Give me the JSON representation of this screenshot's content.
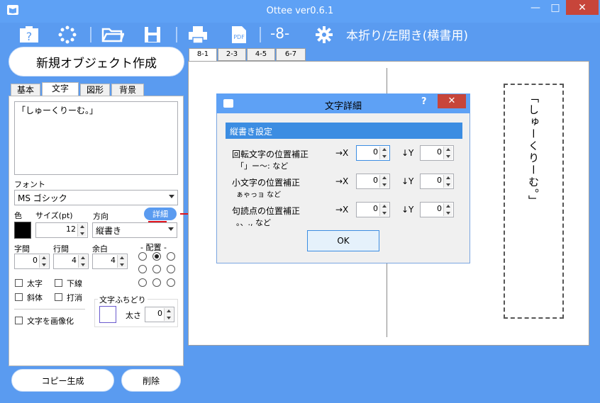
{
  "window": {
    "title": "Ottee ver0.6.1",
    "minimize": "—",
    "maximize": "□",
    "close": "✕"
  },
  "toolbar": {
    "page_indicator": "-8-",
    "layout_label": "本折り/左開き(横書用)"
  },
  "left": {
    "new_object_button": "新規オブジェクト作成",
    "tabs": [
      "基本",
      "文字",
      "図形",
      "背景"
    ],
    "text_value": "「しゅーくりーむ。」",
    "font_label": "フォント",
    "font_value": "MS ゴシック",
    "color_label": "色",
    "size_label": "サイズ(pt)",
    "size_value": "12",
    "direction_label": "方向",
    "detail_button": "詳細",
    "direction_value": "縦書き",
    "char_spacing_label": "字間",
    "char_spacing_value": "0",
    "line_spacing_label": "行間",
    "line_spacing_value": "4",
    "margin_label": "余白",
    "margin_value": "4",
    "alignment_label": "- 配置 -",
    "bold_label": "太字",
    "underline_label": "下線",
    "italic_label": "斜体",
    "strike_label": "打消",
    "outline_group_label": "文字ふちどり",
    "outline_width_label": "太さ",
    "outline_width_value": "0",
    "rasterize_label": "文字を画像化",
    "copy_button": "コピー生成",
    "delete_button": "削除"
  },
  "doc_tabs": [
    "8-1",
    "2-3",
    "4-5",
    "6-7"
  ],
  "canvas": {
    "vertical_text": "「しゅーくりーむ。」"
  },
  "dialog": {
    "title": "文字詳細",
    "help": "?",
    "close": "✕",
    "section_header": "縦書き設定",
    "rows": [
      {
        "label": "回転文字の位置補正",
        "sub": "「」ー〜: など",
        "x_label": "→X",
        "x_value": "0",
        "y_label": "↓Y",
        "y_value": "0"
      },
      {
        "label": "小文字の位置補正",
        "sub": "ぁゃっョ など",
        "x_label": "→X",
        "x_value": "0",
        "y_label": "↓Y",
        "y_value": "0"
      },
      {
        "label": "句読点の位置補正",
        "sub": "。、., など",
        "x_label": "→X",
        "x_value": "0",
        "y_label": "↓Y",
        "y_value": "0"
      }
    ],
    "ok_button": "OK"
  },
  "colors": {
    "accent": "#5a9bf0",
    "dialog_header": "#3c8de2",
    "close_red": "#c7453a",
    "annotation_red": "#e0141e"
  }
}
